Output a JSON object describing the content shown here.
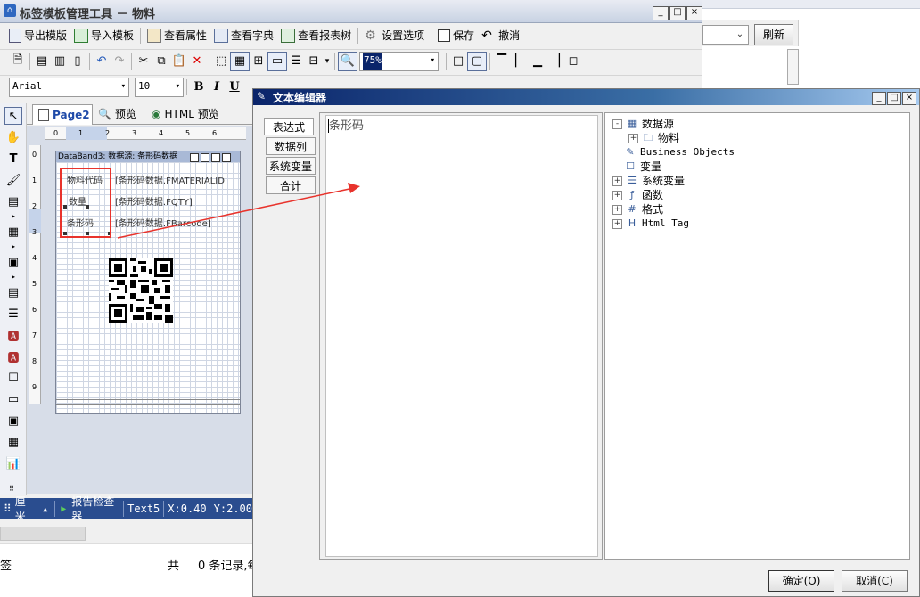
{
  "main_window": {
    "title": "标签模板管理工具 － 物料",
    "toolbar": {
      "export_template": "导出模版",
      "import_template": "导入模板",
      "view_properties": "查看属性",
      "view_dictionary": "查看字典",
      "view_report_tree": "查看报表树",
      "settings": "设置选项",
      "save": "保存",
      "undo": "撤消"
    },
    "zoom_value": "75%",
    "font_name": "Arial",
    "font_size": "10",
    "page_tabs": [
      "Page2",
      "预览",
      "HTML 预览"
    ],
    "ruler_numbers": [
      "0",
      "1",
      "2",
      "3",
      "4",
      "5",
      "6"
    ],
    "vruler_numbers": [
      "0",
      "1",
      "2",
      "3",
      "4",
      "5",
      "6",
      "7",
      "8",
      "9"
    ],
    "band_title": "DataBand3: 数据源: 条形码数据",
    "rows": [
      {
        "label": "物料代码",
        "value": "[条形码数据.FMATERIALID"
      },
      {
        "label": "数量",
        "value": "[条形码数据.FQTY]"
      },
      {
        "label": "条形码",
        "value": "[条形码数据.FBarcode]"
      }
    ],
    "status": {
      "unit": "厘米",
      "inspector": "报告检查器",
      "component": "Text5",
      "x": "X:0.40",
      "y": "Y:2.00"
    },
    "bottom_left": "签",
    "bottom_total": "共",
    "bottom_records": "0 条记录,每"
  },
  "background_window": {
    "refresh_button": "刷新"
  },
  "dialog": {
    "title": "文本编辑器",
    "tabs": [
      "表达式",
      "数据列",
      "系统变量",
      "合计"
    ],
    "editor_text": "条形码",
    "tree": [
      {
        "label": "数据源",
        "icon": "table-icon",
        "expander": "-",
        "indent": 0
      },
      {
        "label": "物料",
        "icon": "folder-icon",
        "expander": "+",
        "indent": 1
      },
      {
        "label": "Business Objects",
        "icon": "business-objects-icon",
        "expander": "",
        "indent": 0
      },
      {
        "label": "变量",
        "icon": "variable-icon",
        "expander": "",
        "indent": 0
      },
      {
        "label": "系统变量",
        "icon": "system-variable-icon",
        "expander": "+",
        "indent": 0
      },
      {
        "label": "函数",
        "icon": "function-icon",
        "expander": "+",
        "indent": 0
      },
      {
        "label": "格式",
        "icon": "format-icon",
        "expander": "+",
        "indent": 0
      },
      {
        "label": "Html Tag",
        "icon": "html-tag-icon",
        "expander": "+",
        "indent": 0
      }
    ],
    "ok_button": "确定(O)",
    "cancel_button": "取消(C)"
  },
  "colors": {
    "dialog_title_bg": "#0a246a",
    "annotation_red": "#e8332c",
    "status_bar_bg": "#2a4d8f"
  }
}
